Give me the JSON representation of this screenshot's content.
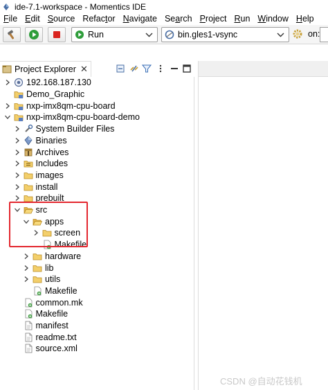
{
  "window": {
    "title": "ide-7.1-workspace - Momentics IDE"
  },
  "menu": [
    {
      "mnemonic": "F",
      "rest": "ile"
    },
    {
      "mnemonic": "E",
      "rest": "dit"
    },
    {
      "mnemonic": "S",
      "rest": "ource"
    },
    {
      "mnemonic": "",
      "rest": "Refac",
      "mid": "t",
      "tail": "or"
    },
    {
      "mnemonic": "N",
      "rest": "avigate"
    },
    {
      "mnemonic": "",
      "rest": "Se",
      "mid": "a",
      "tail": "rch"
    },
    {
      "mnemonic": "P",
      "rest": "roject"
    },
    {
      "mnemonic": "R",
      "rest": "un"
    },
    {
      "mnemonic": "W",
      "rest": "indow"
    },
    {
      "mnemonic": "H",
      "rest": "elp"
    }
  ],
  "toolbar": {
    "launch_mode": "Run",
    "launch_config": "bin.gles1-vsync",
    "on_label": "on:"
  },
  "view": {
    "tab_label": "Project Explorer",
    "close_glyph": "✕"
  },
  "tree": [
    {
      "label": "192.168.187.130",
      "depth": 0,
      "arrow": "collapsed",
      "icon": "target-icon"
    },
    {
      "label": "Demo_Graphic",
      "depth": 0,
      "arrow": "none",
      "icon": "project-icon"
    },
    {
      "label": "nxp-imx8qm-cpu-board",
      "depth": 0,
      "arrow": "collapsed",
      "icon": "project-icon"
    },
    {
      "label": "nxp-imx8qm-cpu-board-demo",
      "depth": 0,
      "arrow": "expanded",
      "icon": "project-icon"
    },
    {
      "label": "System Builder Files",
      "depth": 1,
      "arrow": "collapsed",
      "icon": "tools-icon"
    },
    {
      "label": "Binaries",
      "depth": 1,
      "arrow": "collapsed",
      "icon": "binaries-icon"
    },
    {
      "label": "Archives",
      "depth": 1,
      "arrow": "collapsed",
      "icon": "archives-icon"
    },
    {
      "label": "Includes",
      "depth": 1,
      "arrow": "collapsed",
      "icon": "includes-icon"
    },
    {
      "label": "images",
      "depth": 1,
      "arrow": "collapsed",
      "icon": "folder-icon"
    },
    {
      "label": "install",
      "depth": 1,
      "arrow": "collapsed",
      "icon": "folder-icon"
    },
    {
      "label": "prebuilt",
      "depth": 1,
      "arrow": "collapsed",
      "icon": "folder-icon"
    },
    {
      "label": "src",
      "depth": 1,
      "arrow": "expanded",
      "icon": "folder-open-icon"
    },
    {
      "label": "apps",
      "depth": 2,
      "arrow": "expanded",
      "icon": "folder-open-icon"
    },
    {
      "label": "screen",
      "depth": 3,
      "arrow": "collapsed",
      "icon": "folder-icon"
    },
    {
      "label": "Makefile",
      "depth": 3,
      "arrow": "none",
      "icon": "makefile-icon"
    },
    {
      "label": "hardware",
      "depth": 2,
      "arrow": "collapsed",
      "icon": "folder-icon"
    },
    {
      "label": "lib",
      "depth": 2,
      "arrow": "collapsed",
      "icon": "folder-icon"
    },
    {
      "label": "utils",
      "depth": 2,
      "arrow": "collapsed",
      "icon": "folder-icon"
    },
    {
      "label": "Makefile",
      "depth": 2,
      "arrow": "none",
      "icon": "makefile-icon"
    },
    {
      "label": "common.mk",
      "depth": 1,
      "arrow": "none",
      "icon": "makefile-icon"
    },
    {
      "label": "Makefile",
      "depth": 1,
      "arrow": "none",
      "icon": "makefile-icon"
    },
    {
      "label": "manifest",
      "depth": 1,
      "arrow": "none",
      "icon": "file-icon"
    },
    {
      "label": "readme.txt",
      "depth": 1,
      "arrow": "none",
      "icon": "file-icon"
    },
    {
      "label": "source.xml",
      "depth": 1,
      "arrow": "none",
      "icon": "file-icon"
    }
  ],
  "watermark": "CSDN @自动花钱机",
  "colors": {
    "highlight": "#e3262e",
    "folder": "#e8b94a",
    "run_green": "#2e9d3a",
    "stop_red": "#d9241f"
  }
}
